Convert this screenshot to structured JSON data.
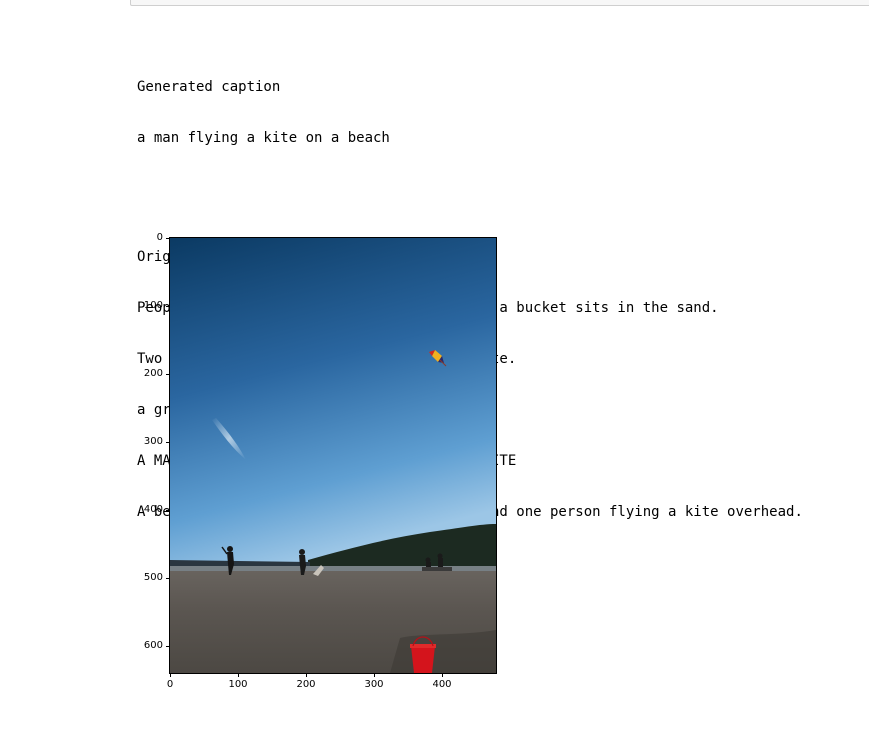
{
  "output": {
    "generated_heading": "Generated caption",
    "generated_caption": "a man flying a kite on a beach",
    "original_heading": "Original captions:",
    "original_captions": [
      "People flying kites on a sandy beach while a bucket sits in the sand.",
      "Two people standing on a beach flying a kite.",
      "a group of people walk on a beach",
      "A MAN AND WOMAN WALKING THE BEACH WITH A KITE",
      "A beach area that has people on the sand and one person flying a kite overhead."
    ]
  },
  "figure": {
    "x_ticks": [
      "0",
      "100",
      "200",
      "300",
      "400"
    ],
    "y_ticks": [
      "0",
      "100",
      "200",
      "300",
      "400",
      "500",
      "600"
    ],
    "x_tick_values": [
      0,
      100,
      200,
      300,
      400
    ],
    "y_tick_values": [
      0,
      100,
      200,
      300,
      400,
      500,
      600
    ],
    "x_range": [
      0,
      480
    ],
    "y_range": [
      0,
      640
    ],
    "y_inverted": true,
    "photo_subject": "beach with people flying a kite and a red bucket in the sand",
    "colors": {
      "sky_top": "#0d3f6b",
      "sky_mid": "#2f6fa8",
      "sky_horizon": "#8dbde0",
      "sand": "#5f5a55",
      "treeline": "#1f2a22",
      "bucket": "#d4141c"
    }
  }
}
